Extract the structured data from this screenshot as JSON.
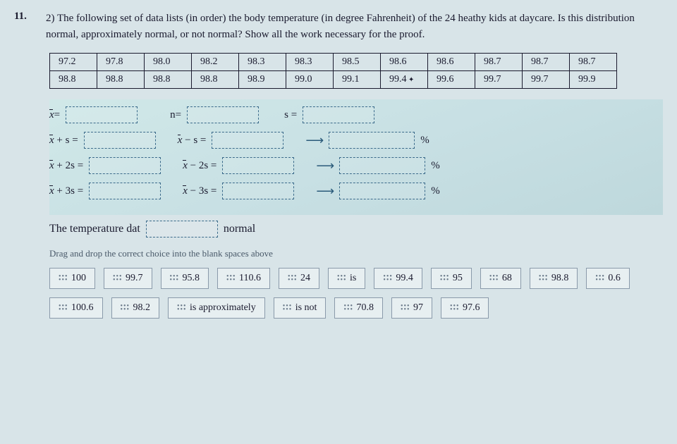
{
  "question": {
    "number": "11.",
    "text": "2) The following set of data lists (in order) the body temperature (in degree Fahrenheit) of the 24 heathy kids at daycare. Is this distribution normal, approximately normal, or not normal? Show all the work necessary for the proof."
  },
  "data_table": {
    "row1": [
      "97.2",
      "97.8",
      "98.0",
      "98.2",
      "98.3",
      "98.3",
      "98.5",
      "98.6",
      "98.6",
      "98.7",
      "98.7",
      "98.7"
    ],
    "row2": [
      "98.8",
      "98.8",
      "98.8",
      "98.8",
      "98.9",
      "99.0",
      "99.1",
      "99.4",
      "99.6",
      "99.7",
      "99.7",
      "99.9"
    ]
  },
  "row2_cursor_index": 7,
  "labels": {
    "xbar_eq": "=",
    "n_eq": "n=",
    "s_eq": "s =",
    "plus_s": " + s =",
    "minus_s": " − s =",
    "plus_2s": " + 2s =",
    "minus_2s": " − 2s =",
    "plus_3s": " + 3s =",
    "minus_3s": " − 3s =",
    "percent": "%",
    "conclusion_pre": "The temperature dat",
    "conclusion_post": "normal",
    "instruction": "Drag and drop the correct choice into the blank spaces above"
  },
  "choices": [
    "100",
    "99.7",
    "95.8",
    "110.6",
    "24",
    "is",
    "99.4",
    "95",
    "68",
    "98.8",
    "0.6",
    "100.6",
    "98.2",
    "is approximately",
    "is not",
    "70.8",
    "97",
    "97.6"
  ],
  "chart_data": {
    "type": "table",
    "title": "Body temperature of 24 healthy kids (°F)",
    "values": [
      97.2,
      97.8,
      98.0,
      98.2,
      98.3,
      98.3,
      98.5,
      98.6,
      98.6,
      98.7,
      98.7,
      98.7,
      98.8,
      98.8,
      98.8,
      98.8,
      98.9,
      99.0,
      99.1,
      99.4,
      99.6,
      99.7,
      99.7,
      99.9
    ]
  }
}
